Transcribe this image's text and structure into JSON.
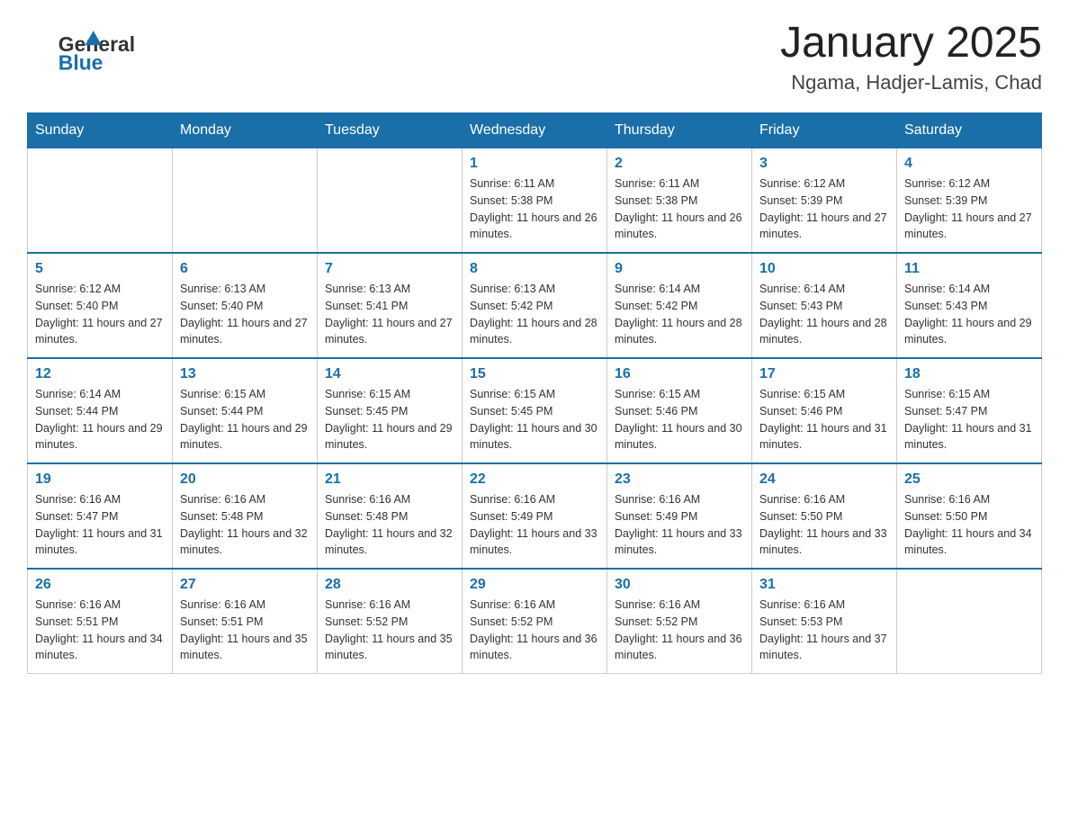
{
  "logo": {
    "general": "General",
    "blue": "Blue"
  },
  "title": "January 2025",
  "subtitle": "Ngama, Hadjer-Lamis, Chad",
  "days_of_week": [
    "Sunday",
    "Monday",
    "Tuesday",
    "Wednesday",
    "Thursday",
    "Friday",
    "Saturday"
  ],
  "weeks": [
    [
      {
        "day": "",
        "info": ""
      },
      {
        "day": "",
        "info": ""
      },
      {
        "day": "",
        "info": ""
      },
      {
        "day": "1",
        "info": "Sunrise: 6:11 AM\nSunset: 5:38 PM\nDaylight: 11 hours and 26 minutes."
      },
      {
        "day": "2",
        "info": "Sunrise: 6:11 AM\nSunset: 5:38 PM\nDaylight: 11 hours and 26 minutes."
      },
      {
        "day": "3",
        "info": "Sunrise: 6:12 AM\nSunset: 5:39 PM\nDaylight: 11 hours and 27 minutes."
      },
      {
        "day": "4",
        "info": "Sunrise: 6:12 AM\nSunset: 5:39 PM\nDaylight: 11 hours and 27 minutes."
      }
    ],
    [
      {
        "day": "5",
        "info": "Sunrise: 6:12 AM\nSunset: 5:40 PM\nDaylight: 11 hours and 27 minutes."
      },
      {
        "day": "6",
        "info": "Sunrise: 6:13 AM\nSunset: 5:40 PM\nDaylight: 11 hours and 27 minutes."
      },
      {
        "day": "7",
        "info": "Sunrise: 6:13 AM\nSunset: 5:41 PM\nDaylight: 11 hours and 27 minutes."
      },
      {
        "day": "8",
        "info": "Sunrise: 6:13 AM\nSunset: 5:42 PM\nDaylight: 11 hours and 28 minutes."
      },
      {
        "day": "9",
        "info": "Sunrise: 6:14 AM\nSunset: 5:42 PM\nDaylight: 11 hours and 28 minutes."
      },
      {
        "day": "10",
        "info": "Sunrise: 6:14 AM\nSunset: 5:43 PM\nDaylight: 11 hours and 28 minutes."
      },
      {
        "day": "11",
        "info": "Sunrise: 6:14 AM\nSunset: 5:43 PM\nDaylight: 11 hours and 29 minutes."
      }
    ],
    [
      {
        "day": "12",
        "info": "Sunrise: 6:14 AM\nSunset: 5:44 PM\nDaylight: 11 hours and 29 minutes."
      },
      {
        "day": "13",
        "info": "Sunrise: 6:15 AM\nSunset: 5:44 PM\nDaylight: 11 hours and 29 minutes."
      },
      {
        "day": "14",
        "info": "Sunrise: 6:15 AM\nSunset: 5:45 PM\nDaylight: 11 hours and 29 minutes."
      },
      {
        "day": "15",
        "info": "Sunrise: 6:15 AM\nSunset: 5:45 PM\nDaylight: 11 hours and 30 minutes."
      },
      {
        "day": "16",
        "info": "Sunrise: 6:15 AM\nSunset: 5:46 PM\nDaylight: 11 hours and 30 minutes."
      },
      {
        "day": "17",
        "info": "Sunrise: 6:15 AM\nSunset: 5:46 PM\nDaylight: 11 hours and 31 minutes."
      },
      {
        "day": "18",
        "info": "Sunrise: 6:15 AM\nSunset: 5:47 PM\nDaylight: 11 hours and 31 minutes."
      }
    ],
    [
      {
        "day": "19",
        "info": "Sunrise: 6:16 AM\nSunset: 5:47 PM\nDaylight: 11 hours and 31 minutes."
      },
      {
        "day": "20",
        "info": "Sunrise: 6:16 AM\nSunset: 5:48 PM\nDaylight: 11 hours and 32 minutes."
      },
      {
        "day": "21",
        "info": "Sunrise: 6:16 AM\nSunset: 5:48 PM\nDaylight: 11 hours and 32 minutes."
      },
      {
        "day": "22",
        "info": "Sunrise: 6:16 AM\nSunset: 5:49 PM\nDaylight: 11 hours and 33 minutes."
      },
      {
        "day": "23",
        "info": "Sunrise: 6:16 AM\nSunset: 5:49 PM\nDaylight: 11 hours and 33 minutes."
      },
      {
        "day": "24",
        "info": "Sunrise: 6:16 AM\nSunset: 5:50 PM\nDaylight: 11 hours and 33 minutes."
      },
      {
        "day": "25",
        "info": "Sunrise: 6:16 AM\nSunset: 5:50 PM\nDaylight: 11 hours and 34 minutes."
      }
    ],
    [
      {
        "day": "26",
        "info": "Sunrise: 6:16 AM\nSunset: 5:51 PM\nDaylight: 11 hours and 34 minutes."
      },
      {
        "day": "27",
        "info": "Sunrise: 6:16 AM\nSunset: 5:51 PM\nDaylight: 11 hours and 35 minutes."
      },
      {
        "day": "28",
        "info": "Sunrise: 6:16 AM\nSunset: 5:52 PM\nDaylight: 11 hours and 35 minutes."
      },
      {
        "day": "29",
        "info": "Sunrise: 6:16 AM\nSunset: 5:52 PM\nDaylight: 11 hours and 36 minutes."
      },
      {
        "day": "30",
        "info": "Sunrise: 6:16 AM\nSunset: 5:52 PM\nDaylight: 11 hours and 36 minutes."
      },
      {
        "day": "31",
        "info": "Sunrise: 6:16 AM\nSunset: 5:53 PM\nDaylight: 11 hours and 37 minutes."
      },
      {
        "day": "",
        "info": ""
      }
    ]
  ]
}
